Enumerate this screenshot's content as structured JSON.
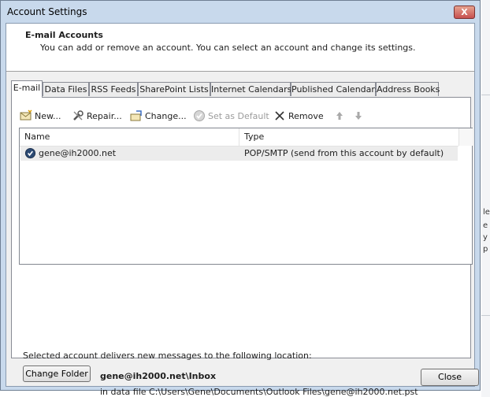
{
  "window": {
    "title": "Account Settings",
    "close_glyph": "X"
  },
  "header": {
    "title": "E-mail Accounts",
    "subtitle": "You can add or remove an account. You can select an account and change its settings."
  },
  "tabs": [
    {
      "label": "E-mail",
      "active": true
    },
    {
      "label": "Data Files"
    },
    {
      "label": "RSS Feeds"
    },
    {
      "label": "SharePoint Lists"
    },
    {
      "label": "Internet Calendars"
    },
    {
      "label": "Published Calendars"
    },
    {
      "label": "Address Books"
    }
  ],
  "toolbar": {
    "new_label": "New...",
    "repair_label": "Repair...",
    "change_label": "Change...",
    "set_default_label": "Set as Default",
    "remove_label": "Remove"
  },
  "accounts_list": {
    "columns": [
      "Name",
      "Type"
    ],
    "rows": [
      {
        "name": "gene@ih2000.net",
        "type": "POP/SMTP (send from this account by default)"
      }
    ]
  },
  "delivery": {
    "label": "Selected account delivers new messages to the following location:",
    "change_folder_label": "Change Folder",
    "inbox_path": "gene@ih2000.net\\Inbox",
    "data_file": "in data file C:\\Users\\Gene\\Documents\\Outlook Files\\gene@ih2000.net.pst"
  },
  "footer": {
    "close_label": "Close"
  },
  "background_fragments": [
    "le",
    "e",
    "y",
    "p"
  ],
  "colors": {
    "accent": "#c8d9ec",
    "close_red": "#c75050"
  }
}
